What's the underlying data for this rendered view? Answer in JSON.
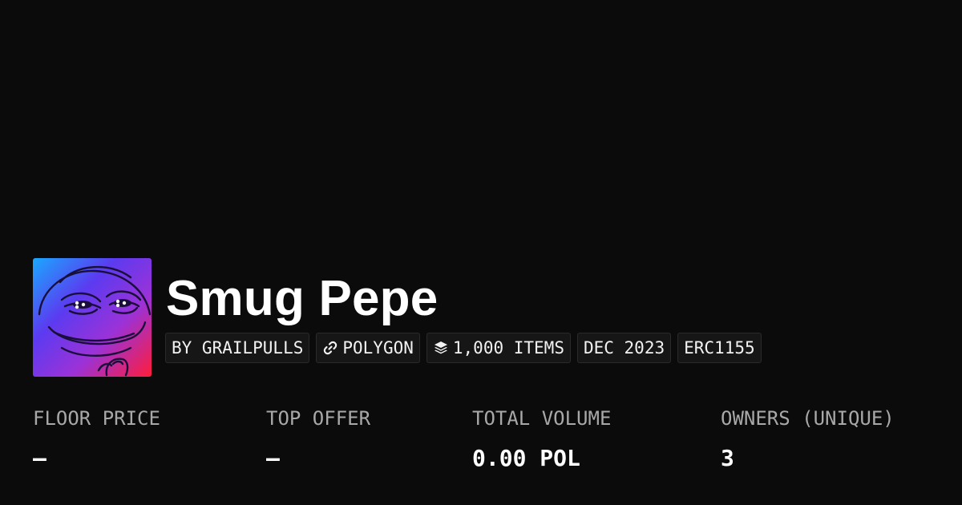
{
  "collection": {
    "name": "Smug Pepe",
    "avatar_icon": "smug-pepe-avatar",
    "avatar_gradient": [
      "#1aa8ff",
      "#5b3bf0",
      "#9b32d8",
      "#ff1d3a"
    ]
  },
  "tags": {
    "creator": "BY GRAILPULLS",
    "chain": "POLYGON",
    "chain_icon": "link-icon",
    "items": "1,000 ITEMS",
    "items_icon": "layers-icon",
    "date": "DEC 2023",
    "standard": "ERC1155"
  },
  "stats": {
    "floor_price": {
      "label": "FLOOR PRICE",
      "value": "–"
    },
    "top_offer": {
      "label": "TOP OFFER",
      "value": "–"
    },
    "total_volume": {
      "label": "TOTAL VOLUME",
      "value": "0.00 POL"
    },
    "owners": {
      "label": "OWNERS (UNIQUE)",
      "value": "3"
    }
  },
  "colors": {
    "background": "#0b0b0b",
    "tag_background": "#161616",
    "label": "#a8a8a8",
    "text": "#ffffff"
  }
}
